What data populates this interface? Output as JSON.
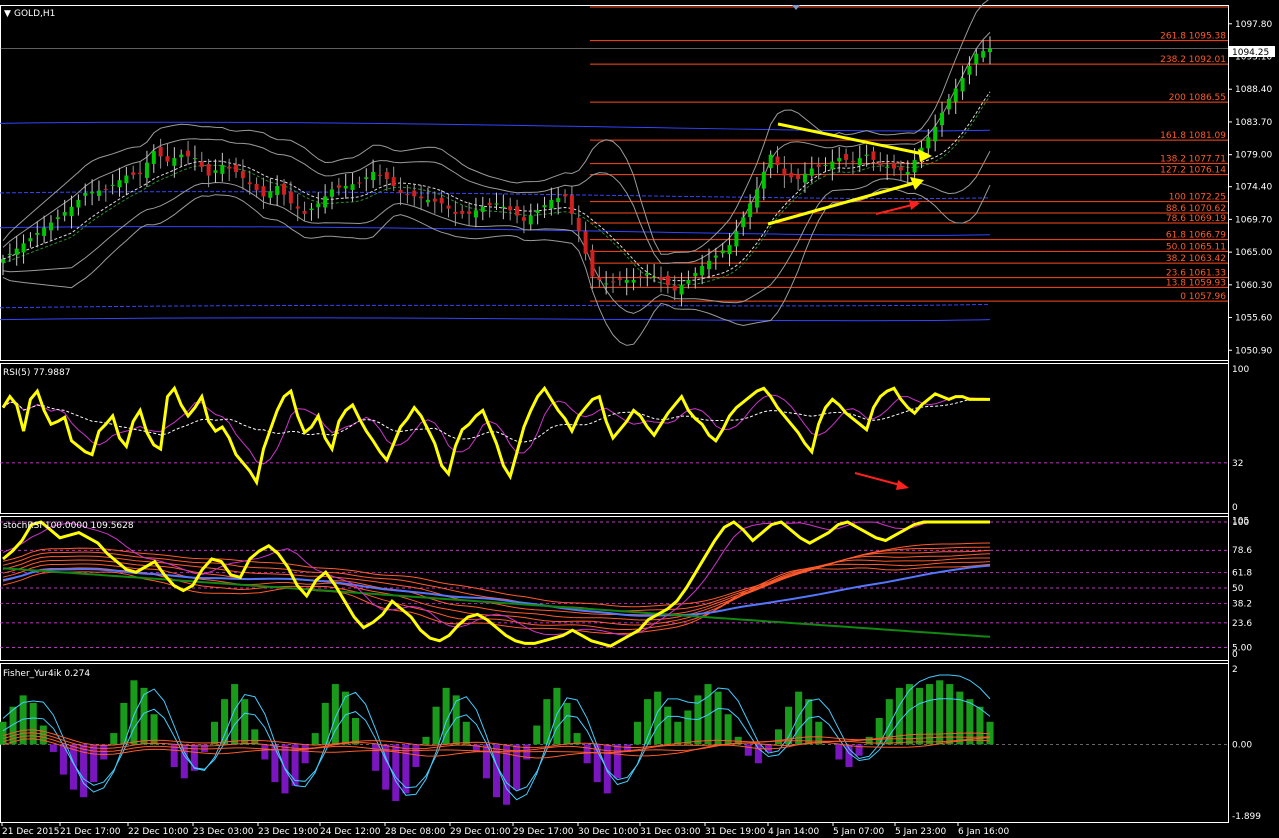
{
  "window": {
    "symbol_title": "GOLD,H1",
    "current_price": "1094.25"
  },
  "colors": {
    "background": "#000000",
    "frame": "#ffffff",
    "bull": "#00c800",
    "bear": "#d02020",
    "fib": "#ff4a1a",
    "band_blue": "#3344ff",
    "rsi": "#ffff00",
    "arrow_yellow": "#ffff00",
    "arrow_red": "#ff2020"
  },
  "chart_data": [
    {
      "type": "candlestick",
      "title": "GOLD,H1",
      "ylim": [
        1049.5,
        1100.5
      ],
      "y_ticks": [
        "1097.80",
        "1093.10",
        "1088.40",
        "1083.70",
        "1079.00",
        "1074.40",
        "1069.70",
        "1065.00",
        "1060.30",
        "1055.60",
        "1050.90"
      ],
      "x_ticks": [
        "21 Dec 2015",
        "21 Dec 17:00",
        "22 Dec 10:00",
        "23 Dec 03:00",
        "23 Dec 19:00",
        "24 Dec 12:00",
        "28 Dec 08:00",
        "29 Dec 01:00",
        "29 Dec 17:00",
        "30 Dec 10:00",
        "31 Dec 03:00",
        "31 Dec 19:00",
        "4 Jan 14:00",
        "5 Jan 07:00",
        "5 Jan 23:00",
        "6 Jan 16:00"
      ],
      "fibonacci_levels": [
        {
          "label": "261.8 1095.38",
          "price": 1095.38
        },
        {
          "label": "238.2 1092.01",
          "price": 1092.01
        },
        {
          "label": "200 1086.55",
          "price": 1086.55
        },
        {
          "label": "161.8 1081.09",
          "price": 1081.09
        },
        {
          "label": "138.2 1077.71",
          "price": 1077.71
        },
        {
          "label": "127.2 1076.14",
          "price": 1076.14
        },
        {
          "label": "100 1072.25",
          "price": 1072.25
        },
        {
          "label": "88.6 1070.62",
          "price": 1070.62
        },
        {
          "label": "78.6 1069.19",
          "price": 1069.19
        },
        {
          "label": "61.8 1066.79",
          "price": 1066.79
        },
        {
          "label": "50.0 1065.11",
          "price": 1065.11
        },
        {
          "label": "38.2 1063.42",
          "price": 1063.42
        },
        {
          "label": "23.6 1061.33",
          "price": 1061.33
        },
        {
          "label": "13.8 1059.93",
          "price": 1059.93
        },
        {
          "label": "0 1057.96",
          "price": 1057.96
        }
      ],
      "close_path": [
        [
          0,
          1064
        ],
        [
          6,
          1068.5
        ],
        [
          10,
          1071.5
        ],
        [
          12,
          1073.5
        ],
        [
          15,
          1074
        ],
        [
          18,
          1076
        ],
        [
          20,
          1076.2
        ],
        [
          22,
          1079.5
        ],
        [
          24,
          1078
        ],
        [
          26,
          1079
        ],
        [
          28,
          1078.5
        ],
        [
          30,
          1076
        ],
        [
          32,
          1077.5
        ],
        [
          34,
          1076.5
        ],
        [
          38,
          1073
        ],
        [
          40,
          1074.5
        ],
        [
          42,
          1072
        ],
        [
          44,
          1070.5
        ],
        [
          46,
          1072
        ],
        [
          48,
          1074
        ],
        [
          50,
          1074.5
        ],
        [
          52,
          1075
        ],
        [
          54,
          1076.5
        ],
        [
          56,
          1075.5
        ],
        [
          58,
          1073.5
        ],
        [
          60,
          1073
        ],
        [
          62,
          1072.5
        ],
        [
          64,
          1072
        ],
        [
          66,
          1070.5
        ],
        [
          68,
          1070.5
        ],
        [
          70,
          1071.5
        ],
        [
          72,
          1072
        ],
        [
          74,
          1071
        ],
        [
          76,
          1069.5
        ],
        [
          78,
          1071
        ],
        [
          80,
          1072.5
        ],
        [
          82,
          1073
        ],
        [
          84,
          1068
        ],
        [
          86,
          1061.5
        ],
        [
          88,
          1060.5
        ],
        [
          90,
          1061
        ],
        [
          92,
          1061
        ],
        [
          94,
          1062
        ],
        [
          96,
          1061
        ],
        [
          98,
          1059.5
        ],
        [
          100,
          1061
        ],
        [
          102,
          1063
        ],
        [
          104,
          1064.5
        ],
        [
          106,
          1066
        ],
        [
          108,
          1070
        ],
        [
          110,
          1074
        ],
        [
          112,
          1079
        ],
        [
          114,
          1076
        ],
        [
          116,
          1075.5
        ],
        [
          118,
          1077
        ],
        [
          120,
          1077.5
        ],
        [
          122,
          1078.5
        ],
        [
          124,
          1078
        ],
        [
          126,
          1079
        ],
        [
          128,
          1077.5
        ],
        [
          130,
          1077
        ],
        [
          132,
          1076.5
        ],
        [
          134,
          1080
        ],
        [
          136,
          1083
        ],
        [
          138,
          1087
        ],
        [
          140,
          1090
        ],
        [
          142,
          1093.5
        ],
        [
          144,
          1094.25
        ]
      ],
      "annotations": [
        "yellow converging trendlines (triangle)",
        "red arrow up"
      ]
    },
    {
      "type": "line",
      "title": "RSI(5) 77.9887",
      "ylim": [
        0,
        100
      ],
      "y_ticks": [
        "100",
        "32",
        "0"
      ],
      "series": [
        {
          "name": "RSI(5)",
          "values": [
            72,
            80,
            74,
            55,
            78,
            84,
            70,
            60,
            62,
            65,
            48,
            44,
            40,
            38,
            55,
            60,
            66,
            50,
            44,
            62,
            70,
            54,
            45,
            42,
            80,
            86,
            74,
            66,
            72,
            80,
            62,
            55,
            58,
            50,
            38,
            32,
            26,
            18,
            42,
            56,
            70,
            80,
            84,
            66,
            54,
            58,
            66,
            50,
            42,
            62,
            70,
            74,
            64,
            55,
            48,
            40,
            34,
            46,
            58,
            64,
            72,
            66,
            56,
            46,
            30,
            24,
            44,
            56,
            60,
            66,
            70,
            58,
            46,
            30,
            22,
            40,
            58,
            70,
            80,
            86,
            78,
            70,
            64,
            55,
            66,
            72,
            78,
            80,
            62,
            50,
            56,
            62,
            70,
            66,
            58,
            52,
            60,
            68,
            74,
            80,
            70,
            64,
            60,
            52,
            48,
            56,
            66,
            72,
            76,
            80,
            84,
            86,
            80,
            72,
            66,
            60,
            54,
            46,
            40,
            60,
            72,
            78,
            74,
            68,
            64,
            60,
            56,
            72,
            80,
            84,
            86,
            78,
            72,
            68,
            74,
            78,
            82,
            80,
            78,
            80,
            80,
            78,
            78,
            78,
            78
          ]
        }
      ],
      "reference_lines": [
        32
      ]
    },
    {
      "type": "line",
      "title": "stochRSI 100.0000 109.5628",
      "ylim": [
        0,
        100
      ],
      "y_ticks": [
        "105",
        "100",
        "78.6",
        "61.8",
        "50",
        "38.2",
        "23.6",
        "5.00",
        "0"
      ],
      "series": [
        {
          "name": "stochRSI",
          "values": [
            72,
            78,
            86,
            98,
            100,
            94,
            88,
            90,
            92,
            88,
            84,
            76,
            70,
            64,
            62,
            66,
            70,
            60,
            52,
            48,
            52,
            64,
            72,
            70,
            60,
            58,
            72,
            78,
            82,
            76,
            66,
            52,
            44,
            56,
            62,
            52,
            40,
            28,
            20,
            24,
            30,
            40,
            34,
            28,
            18,
            12,
            10,
            14,
            22,
            28,
            30,
            26,
            20,
            14,
            10,
            8,
            8,
            10,
            12,
            14,
            18,
            14,
            10,
            8,
            6,
            10,
            14,
            18,
            26,
            30,
            34,
            40,
            50,
            62,
            74,
            86,
            96,
            100,
            94,
            86,
            92,
            98,
            100,
            94,
            88,
            84,
            88,
            92,
            98,
            100,
            96,
            92,
            88,
            86,
            90,
            94,
            98,
            100,
            100,
            100,
            100,
            100,
            100,
            100,
            100
          ]
        }
      ]
    },
    {
      "type": "bar",
      "title": "Fisher_Yur4ik 0.274",
      "ylim": [
        -1.899,
        2
      ],
      "y_ticks": [
        "2",
        "0.00",
        "-1.899"
      ],
      "series": [
        {
          "name": "Fisher_Yur4ik",
          "values": [
            0.6,
            1.0,
            1.3,
            1.1,
            0.5,
            -0.2,
            -0.8,
            -1.2,
            -1.4,
            -1.0,
            -0.4,
            0.3,
            1.1,
            1.7,
            1.5,
            0.8,
            0.0,
            -0.6,
            -0.9,
            -0.7,
            -0.2,
            0.6,
            1.2,
            1.6,
            1.2,
            0.4,
            -0.4,
            -1.0,
            -1.3,
            -1.1,
            -0.5,
            0.3,
            1.1,
            1.6,
            1.4,
            0.7,
            0.0,
            -0.7,
            -1.2,
            -1.5,
            -1.3,
            -0.6,
            0.2,
            1.0,
            1.5,
            1.3,
            0.6,
            -0.2,
            -0.9,
            -1.4,
            -1.6,
            -1.2,
            -0.4,
            0.5,
            1.2,
            1.5,
            1.1,
            0.3,
            -0.5,
            -1.0,
            -1.3,
            -0.9,
            -0.2,
            0.6,
            1.2,
            1.4,
            1.0,
            0.6,
            0.9,
            1.3,
            1.6,
            1.4,
            0.8,
            0.2,
            -0.3,
            -0.5,
            -0.2,
            0.4,
            1.0,
            1.4,
            1.2,
            0.6,
            0.0,
            -0.4,
            -0.6,
            -0.3,
            0.2,
            0.7,
            1.2,
            1.5,
            1.6,
            1.5,
            1.6,
            1.7,
            1.6,
            1.4,
            1.2,
            1.0,
            0.6
          ]
        }
      ]
    }
  ]
}
